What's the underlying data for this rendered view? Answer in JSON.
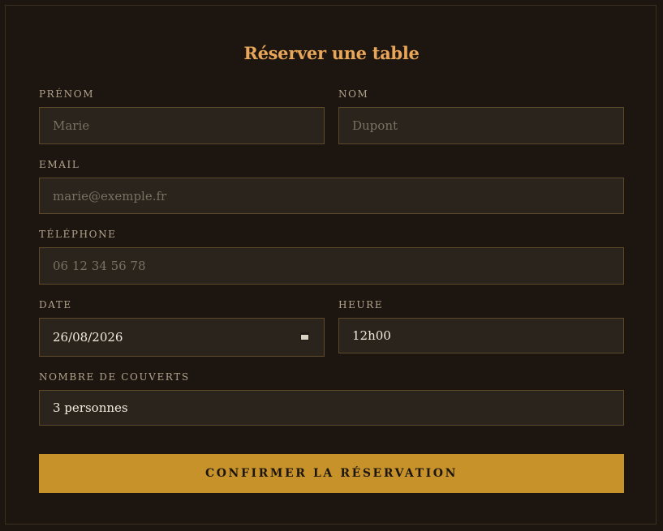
{
  "form": {
    "title": "Réserver une table",
    "fields": {
      "prenom": {
        "label": "PRÉNOM",
        "placeholder": "Marie",
        "value": ""
      },
      "nom": {
        "label": "NOM",
        "placeholder": "Dupont",
        "value": ""
      },
      "email": {
        "label": "EMAIL",
        "placeholder": "marie@exemple.fr",
        "value": ""
      },
      "telephone": {
        "label": "TÉLÉPHONE",
        "placeholder": "06 12 34 56 78",
        "value": ""
      },
      "date": {
        "label": "DATE",
        "value": "26/08/2026"
      },
      "heure": {
        "label": "HEURE",
        "value": "12h00"
      },
      "couverts": {
        "label": "NOMBRE DE COUVERTS",
        "value": "3 personnes"
      }
    },
    "submit_label": "CONFIRMER LA RÉSERVATION"
  },
  "colors": {
    "background": "#1c1510",
    "accent_title": "#e9a658",
    "button": "#c8922a",
    "field_background": "#2a241c",
    "field_border": "#5e4a2a"
  },
  "icons": {
    "date_picker": "calendar-icon"
  }
}
